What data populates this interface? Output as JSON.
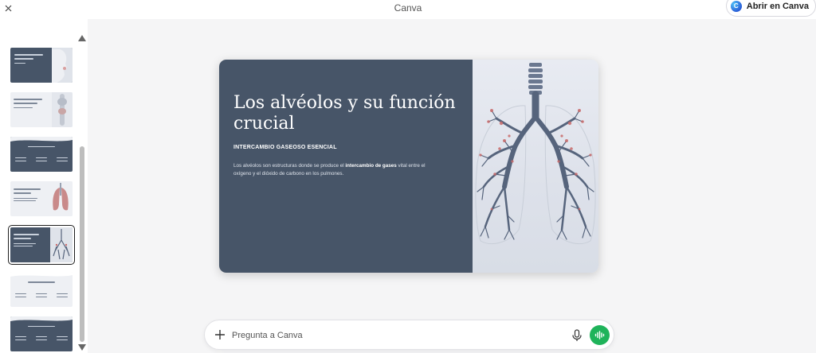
{
  "app": {
    "title": "Canva"
  },
  "toolbar": {
    "close_icon": "close-icon",
    "open_button_label": "Abrir en Canva",
    "logo_letter": "C"
  },
  "sidebar": {
    "scroll_up_icon": "triangle-up-icon",
    "scroll_down_icon": "triangle-down-icon",
    "selected_index": 4,
    "slides": [
      {
        "theme": "dark",
        "image": "face-profile"
      },
      {
        "theme": "light",
        "image": "larynx"
      },
      {
        "theme": "dark",
        "image": "none"
      },
      {
        "theme": "light",
        "image": "lungs-color"
      },
      {
        "theme": "dark",
        "image": "lungs-branch"
      },
      {
        "theme": "light",
        "image": "none"
      },
      {
        "theme": "dark",
        "image": "none"
      }
    ]
  },
  "slide": {
    "title": "Los alvéolos y su función crucial",
    "subtitle": "INTERCAMBIO GASEOSO ESENCIAL",
    "body_before": "Los alvéolos son estructuras donde se produce el ",
    "body_bold": "intercambio de gases",
    "body_after": " vital entre el oxígeno y el dióxido de carbono en los pulmones.",
    "image": "lungs-bronchial-tree-illustration",
    "colors": {
      "panel": "#475568",
      "right_bg": "#e3e7ef",
      "airway": "#56647c",
      "alveoli": "#c96a6a"
    }
  },
  "prompt": {
    "placeholder": "Pregunta a Canva",
    "plus_icon": "plus-icon",
    "mic_icon": "microphone-icon",
    "voice_icon": "voice-wave-icon",
    "voice_color": "#1fb35a"
  }
}
